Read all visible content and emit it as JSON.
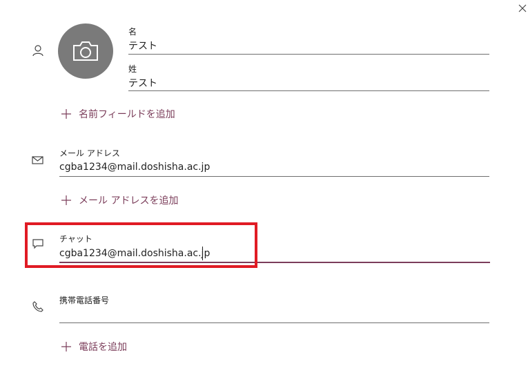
{
  "name_section": {
    "first_name_label": "名",
    "first_name_value": "テスト",
    "last_name_label": "姓",
    "last_name_value": "テスト",
    "add_name_field": "名前フィールドを追加"
  },
  "email_section": {
    "label": "メール アドレス",
    "value": "cgba1234@mail.doshisha.ac.jp",
    "add_label": "メール アドレスを追加"
  },
  "chat_section": {
    "label": "チャット",
    "value": "cgba1234@mail.doshisha.ac.jp"
  },
  "phone_section": {
    "label": "携帯電話番号",
    "value": "",
    "add_label": "電話を追加"
  },
  "colors": {
    "accent": "#7b3d5a",
    "highlight": "#e01b24",
    "photo_bg": "#7a7a7a"
  },
  "icons": [
    "close-icon",
    "person-icon",
    "camera-icon",
    "mail-icon",
    "chat-icon",
    "phone-icon",
    "plus-icon"
  ]
}
